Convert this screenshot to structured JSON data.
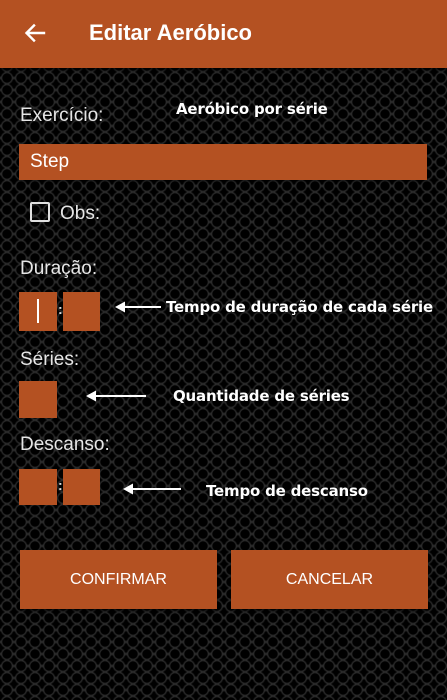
{
  "appbar": {
    "title": "Editar Aeróbico",
    "back_icon": "arrow-left-icon"
  },
  "exercise": {
    "label": "Exercício:",
    "value": "Step",
    "annotation": "Aeróbico por série"
  },
  "obs": {
    "label": "Obs:",
    "checked": false
  },
  "duration": {
    "label": "Duração:",
    "separator": ":",
    "annotation": "Tempo de duração de cada série"
  },
  "series": {
    "label": "Séries:",
    "annotation": "Quantidade de séries"
  },
  "rest": {
    "label": "Descanso:",
    "separator": ":",
    "annotation": "Tempo de descanso"
  },
  "buttons": {
    "confirm": "CONFIRMAR",
    "cancel": "CANCELAR"
  },
  "colors": {
    "accent": "#b45122",
    "background": "#141414",
    "text": "#ffffff"
  }
}
